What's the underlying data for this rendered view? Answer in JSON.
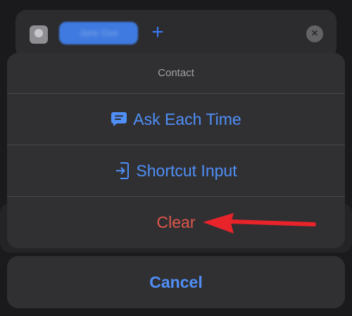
{
  "background": {
    "pill_text": "Jane Doe",
    "plus_glyph": "+",
    "close_glyph": "×"
  },
  "sheet": {
    "title": "Contact",
    "items": [
      {
        "label": "Ask Each Time",
        "icon": "message-bubble-icon",
        "color": "#4f8ff7"
      },
      {
        "label": "Shortcut Input",
        "icon": "shortcut-input-icon",
        "color": "#4f8ff7"
      },
      {
        "label": "Clear",
        "icon": "",
        "color": "#e2574a"
      }
    ]
  },
  "cancel_label": "Cancel",
  "annotation": {
    "type": "arrow",
    "color": "#e8232a",
    "points_to": "Clear"
  }
}
